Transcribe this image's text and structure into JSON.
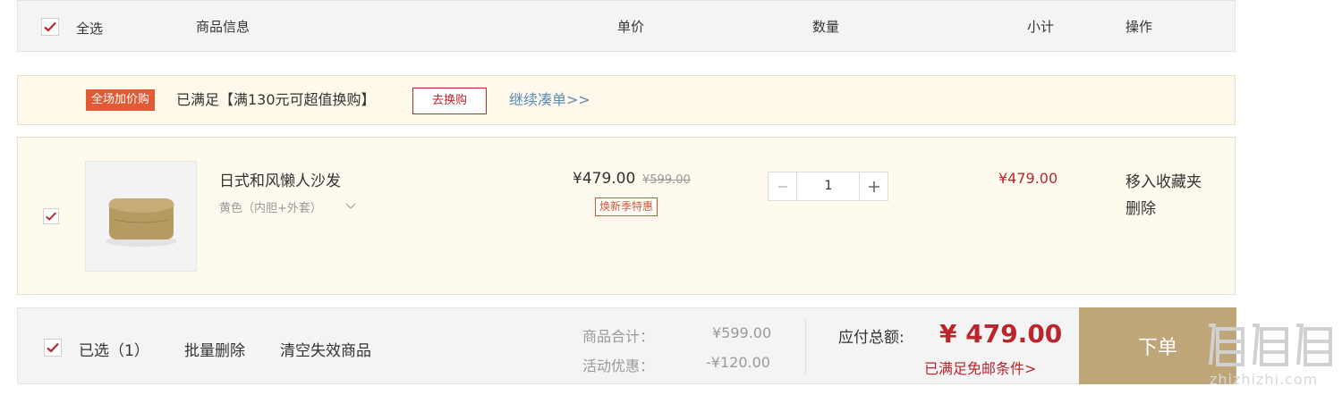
{
  "colors": {
    "accent_red": "#b9262c",
    "tag_orange": "#e05a35",
    "submit_gold": "#bea679",
    "link_blue": "#5b8ab7",
    "row_background": "#fffaee"
  },
  "header": {
    "select_all_checked": true,
    "select_all_label": "全选",
    "col_product": "商品信息",
    "col_unit_price": "单价",
    "col_quantity": "数量",
    "col_subtotal": "小计",
    "col_actions": "操作"
  },
  "promo": {
    "tag": "全场加价购",
    "message": "已满足【满130元可超值换购】",
    "button": "去换购",
    "link": "继续凑单>>"
  },
  "item": {
    "checked": true,
    "image_icon": "beanbag-sofa-image",
    "name": "日式和风懒人沙发",
    "spec": "黄色（内胆+外套）",
    "spec_icon": "chevron-down-icon",
    "price": "¥479.00",
    "original_price": "¥599.00",
    "badge": "焕新季特惠",
    "quantity": "1",
    "subtotal": "¥479.00",
    "action_favorite": "移入收藏夹",
    "action_delete": "删除"
  },
  "footer": {
    "select_checked": true,
    "selected_label": "已选（1）",
    "batch_delete": "批量删除",
    "clear_invalid": "清空失效商品",
    "goods_total_label": "商品合计：",
    "goods_total_value": "¥599.00",
    "discount_label": "活动优惠：",
    "discount_value": "-¥120.00",
    "payable_label": "应付总额:",
    "payable_value": "¥ 479.00",
    "free_shipping": "已满足免邮条件>",
    "submit": "下单"
  },
  "watermark": {
    "logo_text": "值值值",
    "site": "zhizhizhi.com"
  }
}
